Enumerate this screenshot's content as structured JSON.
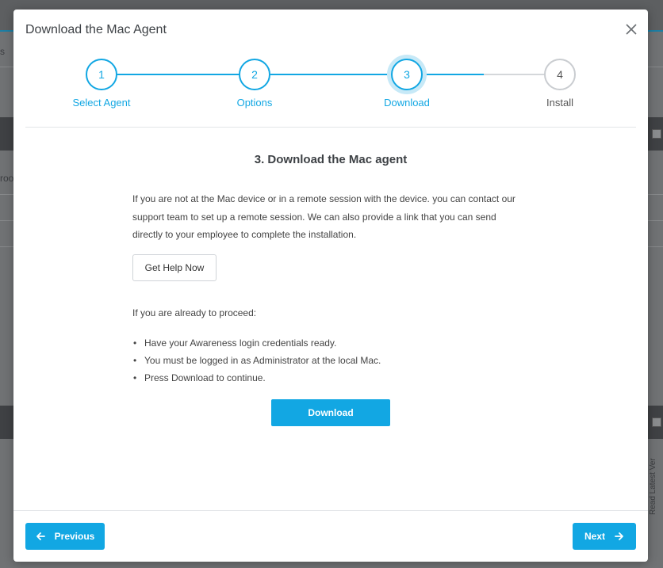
{
  "background": {
    "fragment_left_1": "s",
    "fragment_left_2": "roo",
    "vertical_fragment": "Read Latest Ver"
  },
  "modal": {
    "title": "Download the Mac Agent",
    "close_icon": "close-icon"
  },
  "stepper": {
    "steps": [
      {
        "number": "1",
        "label": "Select Agent",
        "state": "complete"
      },
      {
        "number": "2",
        "label": "Options",
        "state": "complete"
      },
      {
        "number": "3",
        "label": "Download",
        "state": "active"
      },
      {
        "number": "4",
        "label": "Install",
        "state": "future"
      }
    ]
  },
  "content": {
    "heading": "3. Download the Mac agent",
    "paragraph": "If you are not at the Mac device or in a remote session with the device. you can contact our support team to set up a remote session. We can also provide a link that you can send directly to your employee to complete the installation.",
    "help_button": "Get Help Now",
    "proceed_text": "If you are already to proceed:",
    "bullets": [
      "Have your Awareness login credentials ready.",
      "You must be logged in as Administrator at the local Mac.",
      "Press Download to continue."
    ],
    "download_button": "Download"
  },
  "footer": {
    "previous_label": "Previous",
    "previous_icon": "arrow-left-icon",
    "next_label": "Next",
    "next_icon": "arrow-right-icon"
  },
  "colors": {
    "accent": "#12a7e3",
    "inactive_step": "#c9ccd0"
  }
}
